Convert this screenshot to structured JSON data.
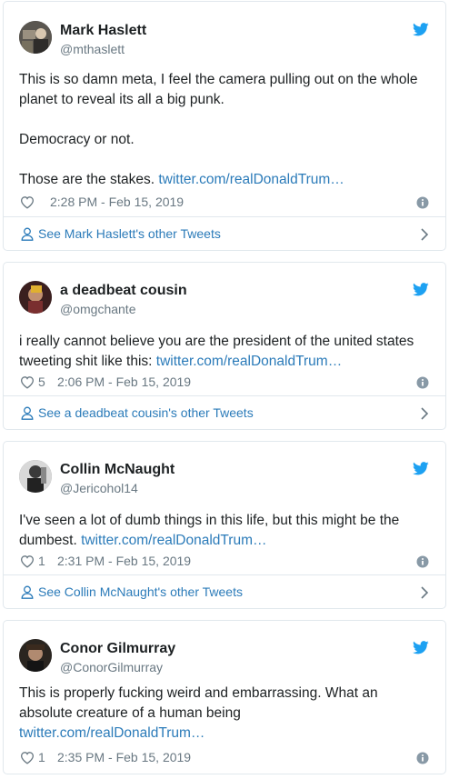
{
  "colors": {
    "link": "#2b7bb9",
    "meta": "#697882",
    "border": "#e1e8ed",
    "bird": "#1da1f2"
  },
  "tweets": [
    {
      "name": "Mark Haslett",
      "handle": "@mthaslett",
      "text": [
        "This is so damn meta, I feel the camera pulling out on the whole planet to reveal its all a big punk.",
        "Democracy or not.",
        "Those are the stakes. "
      ],
      "link": "twitter.com/realDonaldTrum…",
      "likes": "",
      "time": "2:28 PM - Feb 15, 2019",
      "other_tweets": "See Mark Haslett's other Tweets"
    },
    {
      "name": "a deadbeat cousin",
      "handle": "@omgchante",
      "text": [
        "i really cannot believe you are the president of the united states tweeting shit like this: "
      ],
      "link": "twitter.com/realDonaldTrum…",
      "likes": "5",
      "time": "2:06 PM - Feb 15, 2019",
      "other_tweets": "See a deadbeat cousin's other Tweets"
    },
    {
      "name": "Collin McNaught",
      "handle": "@Jericohol14",
      "text": [
        "I've seen a lot of dumb things in this life, but this might be the dumbest. "
      ],
      "link": "twitter.com/realDonaldTrum…",
      "likes": "1",
      "time": "2:31 PM - Feb 15, 2019",
      "other_tweets": "See Collin McNaught's other Tweets"
    },
    {
      "name": "Conor Gilmurray",
      "handle": "@ConorGilmurray",
      "text": [
        "This is properly fucking weird and embarrassing. What an absolute creature of a human being "
      ],
      "link": "twitter.com/realDonaldTrum…",
      "likes": "1",
      "time": "2:35 PM - Feb 15, 2019",
      "other_tweets": ""
    }
  ]
}
